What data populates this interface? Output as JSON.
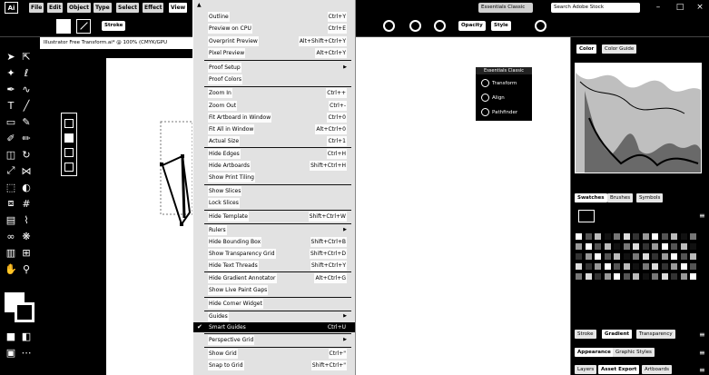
{
  "app": {
    "logo": "Ai",
    "workspace": "Essentials Classic",
    "search_placeholder": "Search Adobe Stock"
  },
  "menubar": {
    "items": [
      {
        "label": "File"
      },
      {
        "label": "Edit"
      },
      {
        "label": "Object"
      },
      {
        "label": "Type"
      },
      {
        "label": "Select"
      },
      {
        "label": "Effect"
      },
      {
        "label": "View"
      }
    ]
  },
  "window_controls": {
    "minimize": "–",
    "maximize": "□",
    "close": "×"
  },
  "controlbar": {
    "stroke_weight_btn": "Stroke",
    "opacity_btn": "Opacity",
    "style_btn": "Style"
  },
  "document": {
    "tab_title": "Illustrator Free Transform.ai* @ 100% (CMYK/GPU"
  },
  "view_menu": {
    "items": [
      {
        "label": "Outline",
        "shortcut": "Ctrl+Y"
      },
      {
        "label": "Preview on CPU",
        "shortcut": "Ctrl+E"
      },
      {
        "label": "Overprint Preview",
        "shortcut": "Alt+Shift+Ctrl+Y"
      },
      {
        "label": "Pixel Preview",
        "shortcut": "Alt+Ctrl+Y"
      },
      {
        "label": "Proof Setup",
        "shortcut": ""
      },
      {
        "label": "Proof Colors",
        "shortcut": ""
      },
      {
        "label": "Zoom In",
        "shortcut": "Ctrl++"
      },
      {
        "label": "Zoom Out",
        "shortcut": "Ctrl+-"
      },
      {
        "label": "Fit Artboard in Window",
        "shortcut": "Ctrl+0"
      },
      {
        "label": "Fit All in Window",
        "shortcut": "Alt+Ctrl+0"
      },
      {
        "label": "Actual Size",
        "shortcut": "Ctrl+1"
      },
      {
        "label": "Hide Edges",
        "shortcut": "Ctrl+H"
      },
      {
        "label": "Hide Artboards",
        "shortcut": "Shift+Ctrl+H"
      },
      {
        "label": "Show Print Tiling",
        "shortcut": ""
      },
      {
        "label": "Show Slices",
        "shortcut": ""
      },
      {
        "label": "Lock Slices",
        "shortcut": ""
      },
      {
        "label": "Hide Template",
        "shortcut": "Shift+Ctrl+W"
      },
      {
        "label": "Rulers",
        "shortcut": ""
      },
      {
        "label": "Hide Bounding Box",
        "shortcut": "Shift+Ctrl+B"
      },
      {
        "label": "Show Transparency Grid",
        "shortcut": "Shift+Ctrl+D"
      },
      {
        "label": "Hide Text Threads",
        "shortcut": "Shift+Ctrl+Y"
      },
      {
        "label": "Hide Gradient Annotator",
        "shortcut": "Alt+Ctrl+G"
      },
      {
        "label": "Show Live Paint Gaps",
        "shortcut": ""
      },
      {
        "label": "Hide Corner Widget",
        "shortcut": ""
      },
      {
        "label": "Guides",
        "shortcut": ""
      },
      {
        "label": "Smart Guides",
        "shortcut": "Ctrl+U"
      },
      {
        "label": "Perspective Grid",
        "shortcut": ""
      },
      {
        "label": "Show Grid",
        "shortcut": "Ctrl+\""
      },
      {
        "label": "Snap to Grid",
        "shortcut": "Shift+Ctrl+\""
      }
    ]
  },
  "float_panel": {
    "title": "Essentials Classic",
    "items": [
      {
        "label": "Transform"
      },
      {
        "label": "Align"
      },
      {
        "label": "Pathfinder"
      }
    ]
  },
  "dock": {
    "top_tabs": [
      {
        "label": "Color"
      },
      {
        "label": "Color Guide"
      }
    ],
    "mid_tabs": [
      {
        "label": "Swatches"
      },
      {
        "label": "Brushes"
      },
      {
        "label": "Symbols"
      }
    ],
    "bottom_tabs": [
      {
        "label": "Stroke"
      },
      {
        "label": "Gradient"
      },
      {
        "label": "Transparency"
      }
    ],
    "bottom_tabs2": [
      {
        "label": "Appearance"
      },
      {
        "label": "Graphic Styles"
      }
    ],
    "bottom_tabs3": [
      {
        "label": "Layers"
      },
      {
        "label": "Asset Export"
      },
      {
        "label": "Artboards"
      }
    ]
  },
  "icons": {
    "selection": "selection-tool-icon",
    "direct": "direct-selection-icon",
    "pen": "pen-tool-icon",
    "type": "type-tool-icon",
    "rect": "rectangle-tool-icon",
    "brush": "paintbrush-icon",
    "rotate": "rotate-tool-icon",
    "scale": "scale-tool-icon",
    "hand": "hand-tool-icon",
    "zoom": "zoom-tool-icon"
  }
}
